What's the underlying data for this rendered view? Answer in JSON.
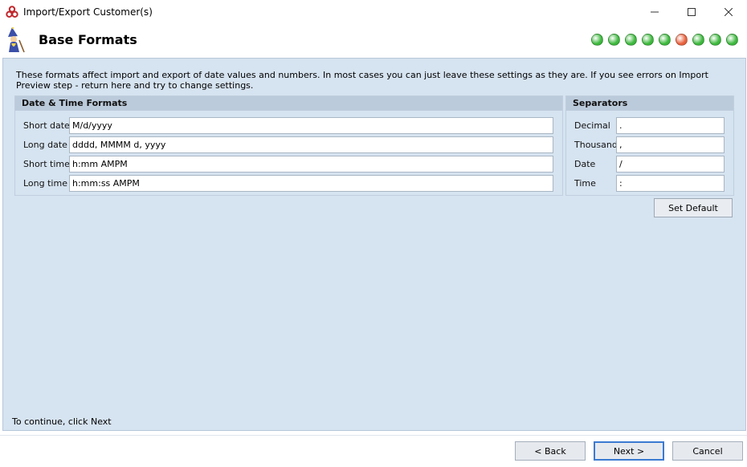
{
  "window": {
    "title": "Import/Export Customer(s)",
    "minimize": "—",
    "maximize": "☐",
    "close": "✕"
  },
  "header": {
    "title": "Base Formats",
    "steps": [
      {
        "state": "done",
        "color": "#3cb83c"
      },
      {
        "state": "done",
        "color": "#3cb83c"
      },
      {
        "state": "done",
        "color": "#3cb83c"
      },
      {
        "state": "done",
        "color": "#3cb83c"
      },
      {
        "state": "done",
        "color": "#3cb83c"
      },
      {
        "state": "current",
        "color": "#e8603c"
      },
      {
        "state": "done",
        "color": "#3cb83c"
      },
      {
        "state": "done",
        "color": "#3cb83c"
      },
      {
        "state": "done",
        "color": "#3cb83c"
      }
    ]
  },
  "description": "These formats affect import and export of date values and numbers. In most cases you can just leave these settings as they are. If you see errors on Import Preview step - return here and try to change settings.",
  "formats": {
    "title": "Date & Time Formats",
    "short_date": {
      "label": "Short date",
      "value": "M/d/yyyy"
    },
    "long_date": {
      "label": "Long date",
      "value": "dddd, MMMM d, yyyy"
    },
    "short_time": {
      "label": "Short time",
      "value": "h:mm AMPM"
    },
    "long_time": {
      "label": "Long time",
      "value": "h:mm:ss AMPM"
    }
  },
  "separators": {
    "title": "Separators",
    "decimal": {
      "label": "Decimal",
      "value": "."
    },
    "thousand": {
      "label": "Thousand",
      "value": ","
    },
    "date": {
      "label": "Date",
      "value": "/"
    },
    "time": {
      "label": "Time",
      "value": ":"
    }
  },
  "buttons": {
    "set_default": "Set Default",
    "back": "< Back",
    "next": "Next >",
    "cancel": "Cancel"
  },
  "hint": "To continue, click Next",
  "colors": {
    "panel_bg": "#d6e3f0",
    "group_header_bg": "#bccbdb",
    "step_done": "#3cb83c",
    "step_current": "#e8603c"
  }
}
